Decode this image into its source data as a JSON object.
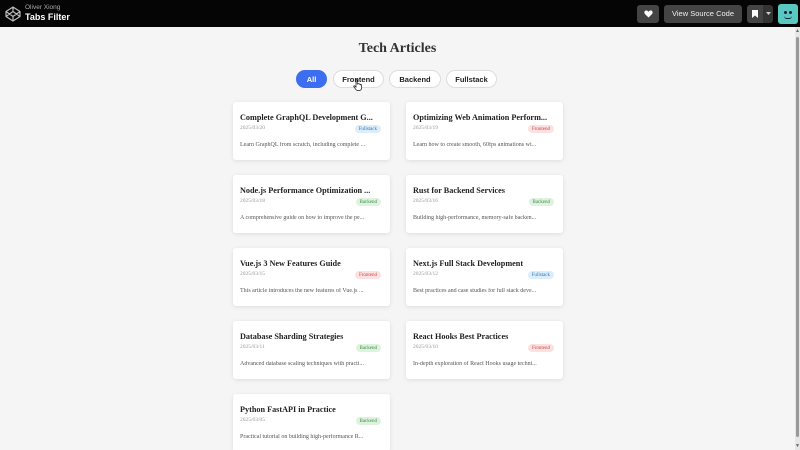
{
  "header": {
    "author": "Oliver Xiong",
    "title": "Tabs Filter",
    "source_button": "View Source Code"
  },
  "main": {
    "heading": "Tech Articles",
    "tabs": [
      {
        "label": "All",
        "active": true
      },
      {
        "label": "Frontend",
        "active": false
      },
      {
        "label": "Backend",
        "active": false
      },
      {
        "label": "Fullstack",
        "active": false
      }
    ]
  },
  "articles": [
    {
      "title": "Complete GraphQL Development G...",
      "date": "2025/03/20",
      "tag": "Fullstack",
      "desc": "Learn GraphQL from scratch, including complete ..."
    },
    {
      "title": "Optimizing Web Animation Perform...",
      "date": "2025/03/19",
      "tag": "Frontend",
      "desc": "Learn how to create smooth, 60fps animations wi..."
    },
    {
      "title": "Node.js Performance Optimization ...",
      "date": "2025/03/18",
      "tag": "Backend",
      "desc": "A comprehensive guide on how to improve the pe..."
    },
    {
      "title": "Rust for Backend Services",
      "date": "2025/03/16",
      "tag": "Backend",
      "desc": "Building high-performance, memory-safe backen..."
    },
    {
      "title": "Vue.js 3 New Features Guide",
      "date": "2025/03/15",
      "tag": "Frontend",
      "desc": "This article introduces the new features of Vue.js ..."
    },
    {
      "title": "Next.js Full Stack Development",
      "date": "2025/03/12",
      "tag": "Fullstack",
      "desc": "Best practices and case studies for full stack deve..."
    },
    {
      "title": "Database Sharding Strategies",
      "date": "2025/03/11",
      "tag": "Backend",
      "desc": "Advanced database scaling techniques with practi..."
    },
    {
      "title": "React Hooks Best Practices",
      "date": "2025/03/10",
      "tag": "Frontend",
      "desc": "In-depth exploration of React Hooks usage techni..."
    },
    {
      "title": "Python FastAPI in Practice",
      "date": "2025/03/05",
      "tag": "Backend",
      "desc": "Practical tutorial on building high-performance R..."
    }
  ],
  "colors": {
    "accent": "#3d6df0",
    "fullstack": "#2a7bbf",
    "frontend": "#d04545",
    "backend": "#3c8f45"
  }
}
